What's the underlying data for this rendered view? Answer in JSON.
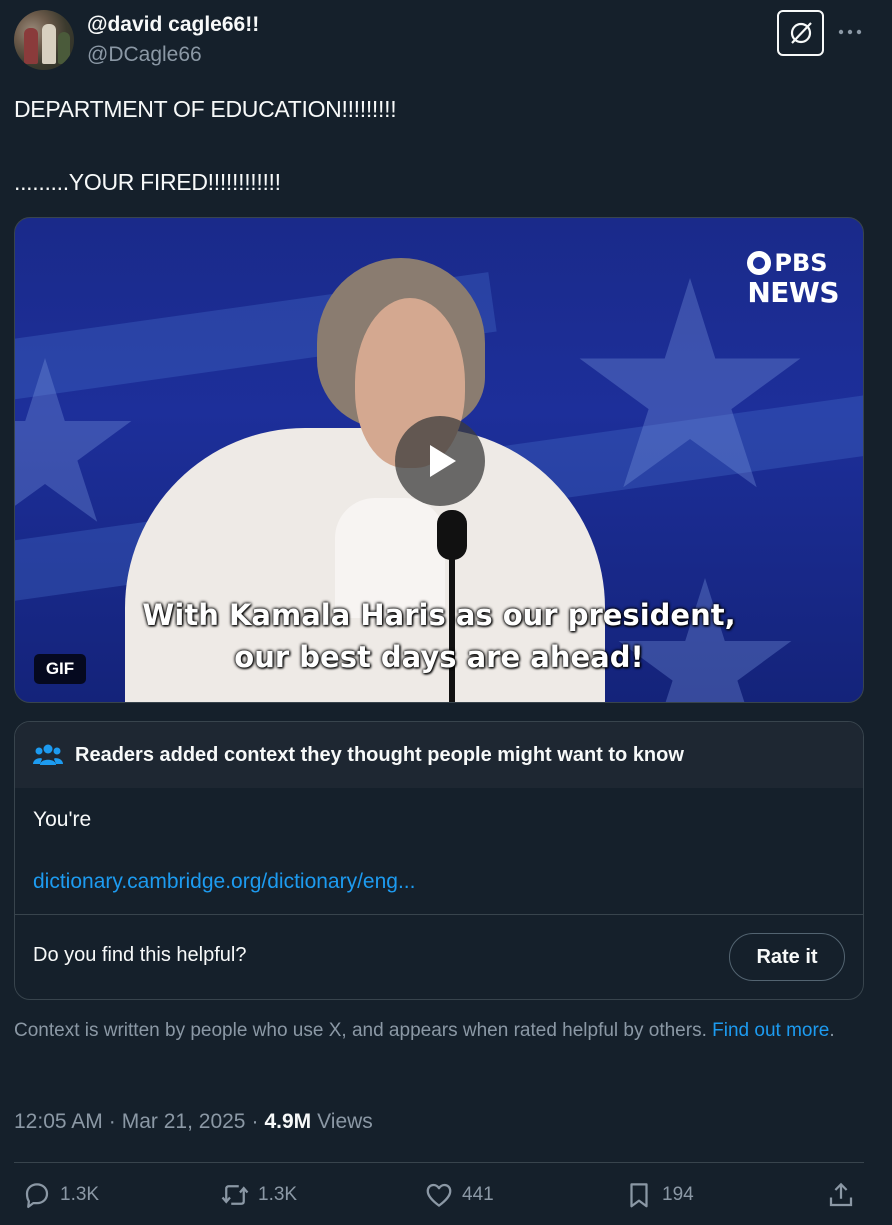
{
  "author": {
    "display_name": "@david cagle66!!",
    "handle": "@DCagle66"
  },
  "post": {
    "line1": "DEPARTMENT OF EDUCATION!!!!!!!!!",
    "line2": ".........YOUR FIRED!!!!!!!!!!!!"
  },
  "media": {
    "logo_top": "PBS",
    "logo_bottom": "NEWS",
    "caption_line1": "With Kamala Haris as our president,",
    "caption_line2": "our best days are ahead!",
    "badge": "GIF"
  },
  "community_note": {
    "title": "Readers added context they thought people might want to know",
    "body": "You're",
    "link": "dictionary.cambridge.org/dictionary/eng...",
    "question": "Do you find this helpful?",
    "rate_label": "Rate it"
  },
  "context_info": {
    "text": "Context is written by people who use X, and appears when rated helpful by others.",
    "link_label": "Find out more",
    "suffix": "."
  },
  "meta": {
    "time": "12:05 AM",
    "separator": "·",
    "date": "Mar 21, 2025",
    "views_count": "4.9M",
    "views_label": "Views"
  },
  "actions": {
    "replies": "1.3K",
    "reposts": "1.3K",
    "likes": "441",
    "bookmarks": "194"
  },
  "colors": {
    "background": "#15202b",
    "accent": "#1d9bf0",
    "muted": "#8b98a5",
    "border": "#38444d"
  }
}
